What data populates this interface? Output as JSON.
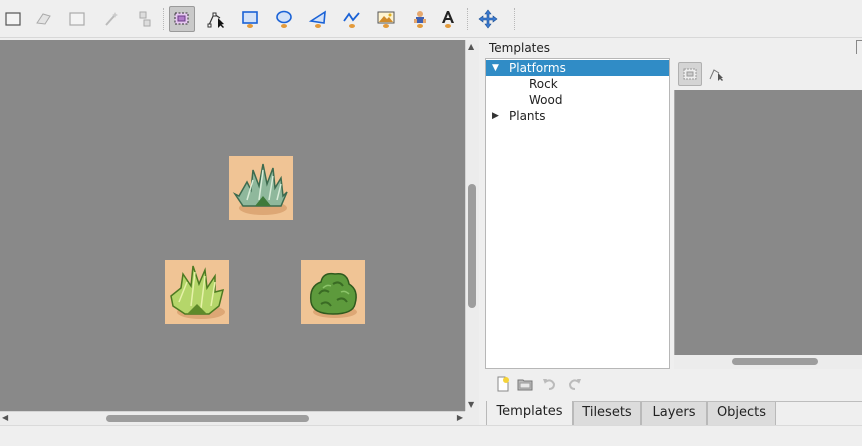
{
  "toolbar": {
    "tools": [
      {
        "name": "select-objects-tool",
        "icon": "rectangle-select-icon",
        "active": false,
        "disabled": false
      },
      {
        "name": "eraser-tool",
        "icon": "eraser-icon",
        "active": false,
        "disabled": true
      },
      {
        "name": "rect-select-tool",
        "icon": "rect-select-icon",
        "active": false,
        "disabled": true
      },
      {
        "name": "magic-wand-tool",
        "icon": "magic-wand-icon",
        "active": false,
        "disabled": true
      },
      {
        "name": "select-same-tile-tool",
        "icon": "same-tile-icon",
        "active": false,
        "disabled": true
      },
      {
        "name": "select-objects-tool-active",
        "icon": "select-objects-icon",
        "active": true,
        "disabled": false
      },
      {
        "name": "edit-polygons-tool",
        "icon": "edit-polygons-icon",
        "active": false,
        "disabled": false
      },
      {
        "name": "insert-rectangle-tool",
        "icon": "rectangle-icon",
        "active": false,
        "disabled": false
      },
      {
        "name": "insert-ellipse-tool",
        "icon": "ellipse-icon",
        "active": false,
        "disabled": false
      },
      {
        "name": "insert-polygon-tool",
        "icon": "polygon-icon",
        "active": false,
        "disabled": false
      },
      {
        "name": "insert-polyline-tool",
        "icon": "polyline-icon",
        "active": false,
        "disabled": false
      },
      {
        "name": "insert-tile-tool",
        "icon": "image-icon",
        "active": false,
        "disabled": false
      },
      {
        "name": "insert-template-tool",
        "icon": "template-icon",
        "active": false,
        "disabled": false
      },
      {
        "name": "insert-text-tool",
        "icon": "text-icon",
        "active": false,
        "disabled": false
      },
      {
        "name": "move-tool",
        "icon": "move-arrows-icon",
        "active": false,
        "disabled": false
      }
    ]
  },
  "colors": {
    "accent": "#308cc6",
    "canvas": "#898989",
    "tool_blue": "#1a62d6",
    "sand": "#f0c495"
  },
  "templates_panel": {
    "title": "Templates",
    "tree": [
      {
        "label": "Platforms",
        "expanded": true,
        "selected": true,
        "children": [
          {
            "label": "Rock"
          },
          {
            "label": "Wood"
          }
        ]
      },
      {
        "label": "Plants",
        "expanded": false,
        "selected": false,
        "children": []
      }
    ]
  },
  "tabs": [
    {
      "label": "Templates",
      "active": true
    },
    {
      "label": "Tilesets",
      "active": false
    },
    {
      "label": "Layers",
      "active": false
    },
    {
      "label": "Objects",
      "active": false
    }
  ],
  "canvas_objects": [
    {
      "name": "pale-green-bush-tile",
      "kind": "pale-bush"
    },
    {
      "name": "light-green-bush-tile",
      "kind": "light-bush"
    },
    {
      "name": "round-green-shrub-tile",
      "kind": "round-shrub"
    }
  ]
}
